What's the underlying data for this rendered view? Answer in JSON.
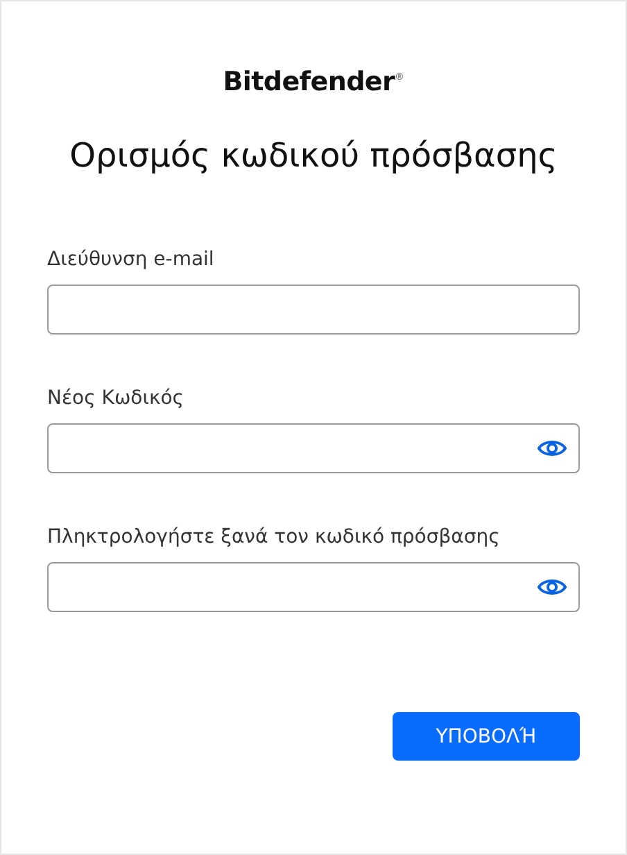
{
  "logo": "Bitdefender$^{®}$",
  "title": "Ορισμός κωδικού πρόσβασης",
  "fields": [
    {
      "label": "Διεύθυνση e-mail",
      "kind": "text"
    },
    {
      "label": "Νέος Κωδικός",
      "kind": "password"
    },
    {
      "label": "Πληκτρολογήστε ξανά τον κωδικό πρόσβασης",
      "kind": "password"
    }
  ],
  "submit": "ΥΠΟΒΟΛΉ"
}
